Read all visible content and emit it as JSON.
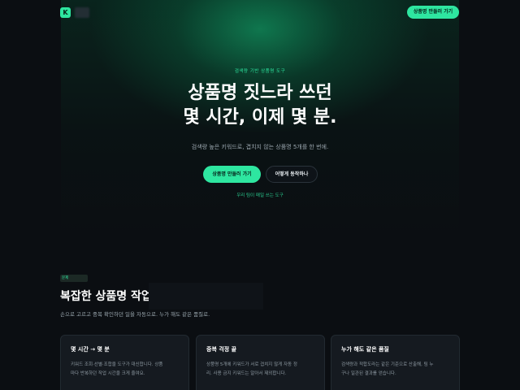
{
  "nav": {
    "logo_letter": "K",
    "cta_label": "상품명 만들러 가기"
  },
  "hero": {
    "eyebrow": "검색량 기반 상품명 도구",
    "title_line1": "상품명 짓느라 쓰던",
    "title_line2": "몇 시간, 이제 몇 분.",
    "subtitle": "검색량 높은 키워드로, 겹치지 않는 상품명 5개를 한 번에.",
    "primary_button": "상품명 만들러 가기",
    "secondary_button": "어떻게 동작하나",
    "tagline": "우리 팀이 매일 쓰는 도구"
  },
  "problem": {
    "badge": "문제",
    "title": "복잡한 상품명 작업",
    "description": "손으로 고르고 중복 확인하던 일을 자동으로. 누가 해도 같은 품질로.",
    "cards": [
      {
        "title": "몇 시간 → 몇 분",
        "text_line1": "키워드 조회·선별·조합을 도구가 대신합니다. 상품",
        "text_line2": "마다 반복하던 작업 시간을 크게 줄여요."
      },
      {
        "title": "중복 걱정 끝",
        "text_line1": "상품명 5개에 키워드가 서로 겹치지 않게 자동 정",
        "text_line2": "리. 사용 금지 키워드는 알아서 제외합니다."
      },
      {
        "title": "누가 해도 같은 품질",
        "text_line1": "검색량과 적합도라는 같은 기준으로 산출해, 팀 누",
        "text_line2": "구나 일관된 결과를 얻습니다."
      }
    ]
  },
  "colors": {
    "accent": "#2ee6a0",
    "background": "#0b0e12",
    "card": "#151a20"
  }
}
